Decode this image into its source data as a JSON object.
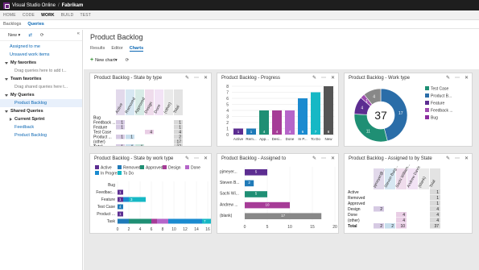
{
  "topbar": {
    "product": "Visual Studio Online",
    "separator": "/",
    "project": "Fabrikam"
  },
  "hubs": [
    {
      "label": "HOME",
      "active": false
    },
    {
      "label": "CODE",
      "active": false
    },
    {
      "label": "WORK",
      "active": true
    },
    {
      "label": "BUILD",
      "active": false
    },
    {
      "label": "TEST",
      "active": false
    }
  ],
  "subtabs": [
    {
      "label": "Backlogs",
      "active": false
    },
    {
      "label": "Queries",
      "active": true
    }
  ],
  "left": {
    "new_label": "New",
    "collapse": "«",
    "assigned": "Assigned to me",
    "unsaved": "Unsaved work items",
    "my_fav": "My favorites",
    "my_fav_hint": "Drag queries here to add t...",
    "team_fav": "Team favorites",
    "team_fav_hint": "Drag shared queries here t...",
    "my_queries": "My Queries",
    "product_backlog": "Product Backlog",
    "shared": "Shared Queries",
    "current_sprint": "Current Sprint",
    "feedback": "Feedback",
    "product_backlog2": "Product Backlog"
  },
  "main": {
    "title": "Product Backlog",
    "tabs": [
      {
        "label": "Results",
        "active": false
      },
      {
        "label": "Editor",
        "active": false
      },
      {
        "label": "Charts",
        "active": true
      }
    ],
    "new_chart": "New chart",
    "new_chart_arrow": "▾"
  },
  "tile_icons": {
    "edit": "✎",
    "more": "⋯",
    "close": "✕"
  },
  "colors": {
    "active": "#5c2d91",
    "removed": "#1f7ab8",
    "approved": "#1f8f74",
    "design": "#a63c97",
    "done": "#b565c9",
    "in_progress": "#1b8bd0",
    "to_do": "#16b8c5",
    "bug": "#8b2c9f",
    "feedback": "#9e4cb0",
    "feature": "#5c2d91",
    "test_case": "#1f8f74",
    "product": "#2a6da8",
    "other": "#888888",
    "progress_bar": "#555555"
  },
  "charts": [
    {
      "id": "state-by-type",
      "type": "table",
      "title": "Product Backlog - State by type",
      "columns": [
        "Active",
        "Removed",
        "Approved",
        "Design",
        "Done",
        "(other)",
        "Total"
      ],
      "rows": [
        {
          "label": "Bug",
          "values": [
            "",
            "",
            "",
            "",
            "",
            "",
            ""
          ]
        },
        {
          "label": "Feedback ...",
          "values": [
            "1",
            "",
            "",
            "",
            "",
            "",
            "1"
          ]
        },
        {
          "label": "Feature",
          "values": [
            "1",
            "",
            "",
            "",
            "",
            "",
            "1"
          ]
        },
        {
          "label": "Test Case",
          "values": [
            "",
            "",
            "",
            "4",
            "",
            "",
            "4"
          ]
        },
        {
          "label": "Product ...",
          "values": [
            "1",
            "1",
            "",
            "",
            "",
            "",
            "2"
          ]
        },
        {
          "label": "(other)",
          "values": [
            "",
            "",
            "",
            "",
            "",
            "",
            "17"
          ]
        },
        {
          "label": "Total",
          "values": [
            "1",
            "4",
            "4",
            "",
            "",
            "",
            "37"
          ]
        }
      ]
    },
    {
      "id": "progress",
      "type": "bar",
      "title": "Product Backlog - Progress",
      "categories": [
        "Active",
        "Rem...",
        "App...",
        "Desi...",
        "Done",
        "In P...",
        "To Do",
        "New"
      ],
      "values": [
        1,
        1,
        4,
        4,
        4,
        6,
        7,
        8
      ],
      "ylim": [
        0,
        8
      ],
      "yticks": [
        0,
        1,
        2,
        3,
        4,
        5,
        6,
        7,
        8
      ]
    },
    {
      "id": "work-type",
      "type": "pie",
      "title": "Product Backlog - Work type",
      "center_label": "37",
      "slices": [
        {
          "name": "Test Case",
          "value": 17,
          "label": "17"
        },
        {
          "name": "Product B...",
          "value": 11,
          "label": "11"
        },
        {
          "name": "Feature",
          "value": 4,
          "label": "4"
        },
        {
          "name": "Feedback ...",
          "value": 1,
          "label": "1"
        },
        {
          "name": "Bug",
          "value": 4,
          "label": "4"
        }
      ]
    },
    {
      "id": "state-by-work-type",
      "type": "bar",
      "title": "Product Backlog - State by work type",
      "legend": [
        "Active",
        "Removed",
        "Approved",
        "Design",
        "Done",
        "In Progress",
        "To Do"
      ],
      "categories": [
        "Bug",
        "Feedbac...",
        "Feature",
        "Test Case",
        "Product ...",
        "Task"
      ],
      "series": [
        {
          "name": "Active",
          "values": [
            0,
            1,
            1,
            0,
            1,
            0
          ]
        },
        {
          "name": "Removed",
          "values": [
            0,
            0,
            0,
            1,
            0,
            2
          ]
        },
        {
          "name": "Approved",
          "values": [
            0,
            0,
            0,
            0,
            0,
            4
          ]
        },
        {
          "name": "Design",
          "values": [
            0,
            0,
            0,
            0,
            0,
            1
          ]
        },
        {
          "name": "Done",
          "values": [
            0,
            0,
            0,
            0,
            0,
            2
          ]
        },
        {
          "name": "In Progress",
          "values": [
            0,
            0,
            1,
            0,
            0,
            6
          ]
        },
        {
          "name": "To Do",
          "values": [
            0,
            0,
            3,
            0,
            0,
            3
          ]
        }
      ],
      "stack_labels": [
        [
          "",
          "",
          "",
          "",
          "",
          "",
          ""
        ],
        [
          "1",
          "",
          "",
          "",
          "",
          "",
          ""
        ],
        [
          "1",
          "",
          "",
          "",
          "",
          "",
          "3"
        ],
        [
          "",
          "4",
          "",
          "",
          "",
          "",
          ""
        ],
        [
          "1",
          "",
          "",
          "",
          "",
          "",
          ""
        ],
        [
          "",
          "",
          "",
          "",
          "",
          "",
          "7"
        ]
      ],
      "xlim": [
        0,
        16
      ],
      "xticks": [
        0,
        2,
        4,
        6,
        8,
        10,
        12,
        14,
        16
      ]
    },
    {
      "id": "assigned-to",
      "type": "bar",
      "title": "Product Backlog - Assigned to",
      "categories": [
        "pjmeyer...",
        "Steven B...",
        "Sachi Wi...",
        "Andrew ...",
        "(blank)"
      ],
      "values": [
        5,
        2,
        5,
        10,
        17
      ],
      "xlim": [
        0,
        20
      ],
      "xticks": [
        0,
        5,
        10,
        15,
        20
      ]
    },
    {
      "id": "assigned-by-state",
      "type": "table",
      "title": "Product Backlog - Assigned to by State",
      "columns": [
        "pjmeyer@...",
        "Steven Burg...",
        "Sachi William...",
        "Andrew Davis",
        "(blank)",
        "Total"
      ],
      "rows": [
        {
          "label": "Active",
          "values": [
            "",
            "",
            "",
            "",
            "",
            "1"
          ]
        },
        {
          "label": "Removed",
          "values": [
            "",
            "",
            "",
            "",
            "",
            "1"
          ]
        },
        {
          "label": "Approved",
          "values": [
            "",
            "",
            "",
            "",
            "",
            "1"
          ]
        },
        {
          "label": "Design",
          "values": [
            "2",
            "",
            "",
            "",
            "",
            "4"
          ]
        },
        {
          "label": "Done",
          "values": [
            "",
            "",
            "4",
            "",
            "",
            "4"
          ]
        },
        {
          "label": "(other)",
          "values": [
            "",
            "",
            "4",
            "",
            "",
            "4"
          ]
        },
        {
          "label": "Total",
          "values": [
            "2",
            "2",
            "10",
            "",
            "",
            "37"
          ]
        }
      ]
    }
  ]
}
